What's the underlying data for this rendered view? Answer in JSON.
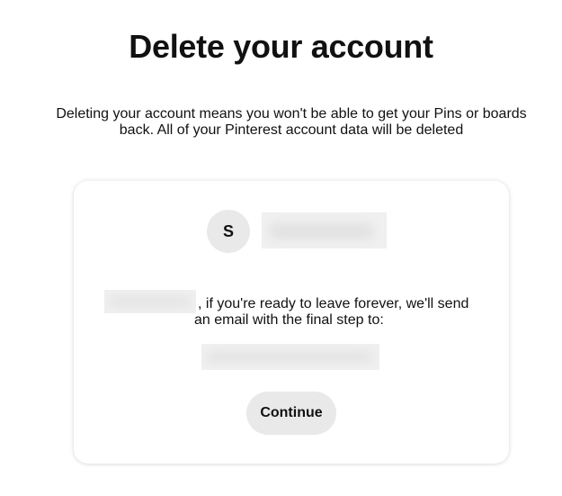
{
  "page": {
    "title": "Delete your account",
    "subtitle": "Deleting your account means you won't be able to get your Pins or boards back. All of your Pinterest account data will be deleted"
  },
  "card": {
    "avatar_initial": "S",
    "message_line1": ", if you're ready to leave forever, we'll send",
    "message_line2": "an email with the final step to:",
    "continue_label": "Continue"
  }
}
